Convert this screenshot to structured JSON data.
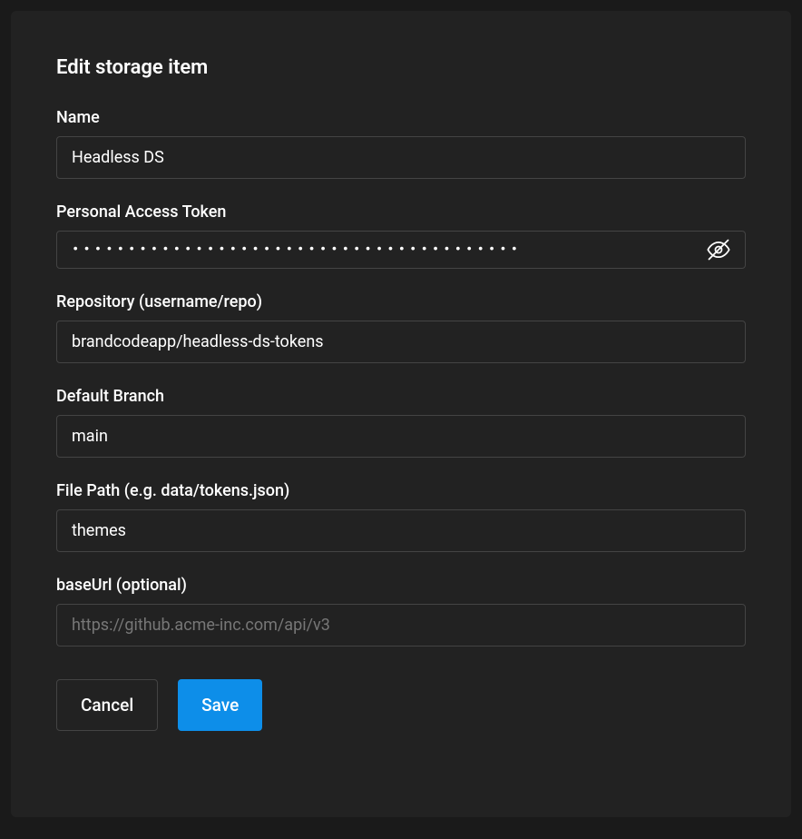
{
  "dialog": {
    "title": "Edit storage item"
  },
  "fields": {
    "name": {
      "label": "Name",
      "value": "Headless DS"
    },
    "token": {
      "label": "Personal Access Token",
      "value": "••••••••••••••••••••••••••••••••••••••••"
    },
    "repository": {
      "label": "Repository (username/repo)",
      "value": "brandcodeapp/headless-ds-tokens"
    },
    "branch": {
      "label": "Default Branch",
      "value": "main"
    },
    "filepath": {
      "label": "File Path (e.g. data/tokens.json)",
      "value": "themes"
    },
    "baseurl": {
      "label": "baseUrl (optional)",
      "placeholder": "https://github.acme-inc.com/api/v3",
      "value": ""
    }
  },
  "buttons": {
    "cancel": "Cancel",
    "save": "Save"
  }
}
